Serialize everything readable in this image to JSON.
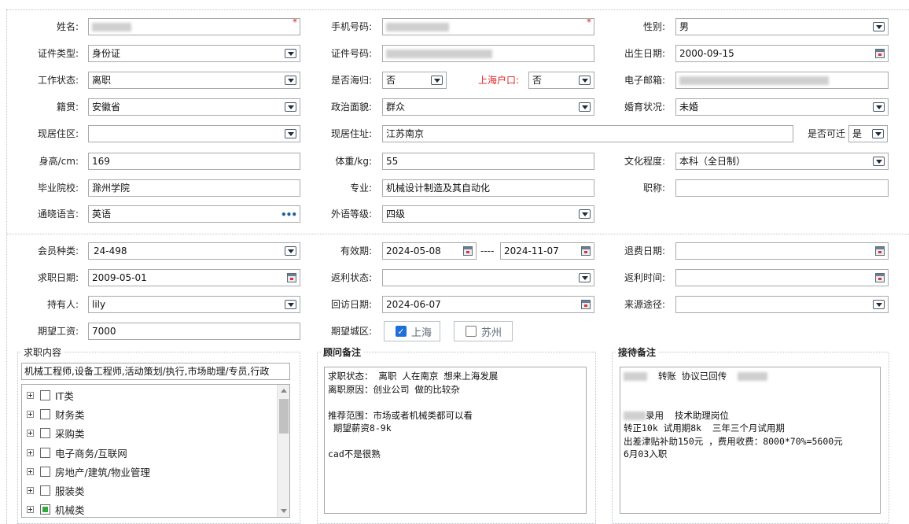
{
  "basic": {
    "name": {
      "label": "姓名:",
      "value": "",
      "required": "*"
    },
    "phone": {
      "label": "手机号码:",
      "value": "",
      "required": "*"
    },
    "gender": {
      "label": "性别:",
      "value": "男"
    },
    "id_type": {
      "label": "证件类型:",
      "value": "身份证"
    },
    "id_number": {
      "label": "证件号码:",
      "value": ""
    },
    "birth_date": {
      "label": "出生日期:",
      "value": "2000-09-15"
    },
    "work_status": {
      "label": "工作状态:",
      "value": "离职"
    },
    "returnee": {
      "label": "是否海归:",
      "value": "否"
    },
    "shanghai_hukou": {
      "label": "上海户口:",
      "value": "否"
    },
    "email": {
      "label": "电子邮箱:",
      "value": ""
    },
    "native_place": {
      "label": "籍贯:",
      "value": "安徽省"
    },
    "political": {
      "label": "政治面貌:",
      "value": "群众"
    },
    "marital": {
      "label": "婚育状况:",
      "value": "未婚"
    },
    "residence_area": {
      "label": "现居住区:",
      "value": ""
    },
    "residence_address": {
      "label": "现居住址:",
      "value": "江苏南京"
    },
    "relocatable": {
      "label": "是否可迁",
      "value": "是"
    },
    "height": {
      "label": "身高/cm:",
      "value": "169"
    },
    "weight": {
      "label": "体重/kg:",
      "value": "55"
    },
    "education": {
      "label": "文化程度:",
      "value": "本科（全日制）"
    },
    "school": {
      "label": "毕业院校:",
      "value": "滁州学院"
    },
    "major": {
      "label": "专业:",
      "value": "机械设计制造及其自动化"
    },
    "title": {
      "label": "职称:",
      "value": ""
    },
    "language": {
      "label": "通晓语言:",
      "value": "英语"
    },
    "language_level": {
      "label": "外语等级:",
      "value": "四级"
    }
  },
  "membership": {
    "member_type": {
      "label": "会员种类:",
      "value": "24-498"
    },
    "valid_period": {
      "label": "有效期:",
      "start": "2024-05-08",
      "separator": "----",
      "end": "2024-11-07"
    },
    "refund_date": {
      "label": "退费日期:",
      "value": ""
    },
    "job_seek_date": {
      "label": "求职日期:",
      "value": "2009-05-01"
    },
    "rebate_status": {
      "label": "返利状态:",
      "value": ""
    },
    "rebate_time": {
      "label": "返利时间:",
      "value": ""
    },
    "holder": {
      "label": "持有人:",
      "value": "lily"
    },
    "revisit_date": {
      "label": "回访日期:",
      "value": "2024-06-07"
    },
    "source": {
      "label": "来源途径:",
      "value": ""
    },
    "expected_salary": {
      "label": "期望工资:",
      "value": "7000"
    },
    "expected_city": {
      "label": "期望城区:",
      "options": [
        {
          "label": "上海",
          "checked": true
        },
        {
          "label": "苏州",
          "checked": false
        }
      ]
    }
  },
  "job_intent": {
    "title": "求职内容",
    "summary": "机械工程师,设备工程师,活动策划/执行,市场助理/专员,行政",
    "tree": [
      {
        "label": "IT类",
        "state": "none"
      },
      {
        "label": "财务类",
        "state": "none"
      },
      {
        "label": "采购类",
        "state": "none"
      },
      {
        "label": "电子商务/互联网",
        "state": "none"
      },
      {
        "label": "房地产/建筑/物业管理",
        "state": "none"
      },
      {
        "label": "服装类",
        "state": "none"
      },
      {
        "label": "机械类",
        "state": "partial"
      }
    ]
  },
  "advisor_notes": {
    "title": "顾问备注",
    "text": "求职状态： 离职 人在南京 想来上海发展\n离职原因：创业公司 做的比较杂\n\n推荐范围：市场或者机械类都可以看\n 期望薪资8-9k\n\ncad不是很熟"
  },
  "reception_notes": {
    "title": "接待备注",
    "line1": "转账 协议已回传",
    "line2": "录用  技术助理岗位",
    "line3": "转正10k 试用期8k  三年三个月试用期",
    "line4": "出差津贴补助150元 ，费用收费：8000*70%=5600元",
    "line5": "6月03入职"
  },
  "icons": {
    "dropdown": "chevron-down-icon",
    "calendar": "calendar-icon",
    "more": "ellipsis-icon",
    "expander": "plus-square-icon"
  }
}
